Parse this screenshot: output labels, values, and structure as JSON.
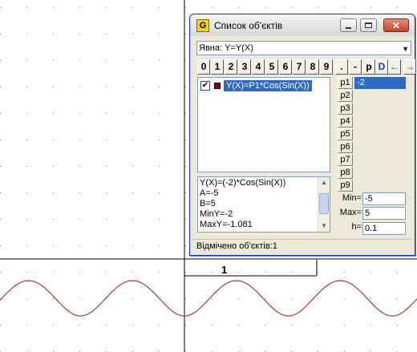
{
  "canvas": {
    "axis_tick_label": "1",
    "curve_color": "#a83a3a"
  },
  "window": {
    "app_icon_letter": "G",
    "title": "Список об'єктів"
  },
  "combo": {
    "value": "Явна: Y=Y(X)"
  },
  "keypad": [
    "0",
    "1",
    "2",
    "3",
    "4",
    "5",
    "6",
    "7",
    "8",
    "9",
    ".",
    "-",
    "p",
    "D",
    "←",
    "→"
  ],
  "objects": [
    {
      "checked": true,
      "color": "#8b0000",
      "label": "Y(X)=P1*Cos(Sin(X))"
    }
  ],
  "parameters": {
    "names": [
      "p1",
      "p2",
      "p3",
      "p4",
      "p5",
      "p6",
      "p7",
      "p8",
      "p9"
    ],
    "p1_value": "-2"
  },
  "properties": [
    "Y(X)=(-2)*Cos(Sin(X))",
    "A=-5",
    "B=5",
    "MinY=-2",
    "MaxY=-1.081"
  ],
  "range": {
    "min_label": "Min=",
    "min_value": "-5",
    "max_label": "Max=",
    "max_value": "5",
    "h_label": "h=",
    "h_value": "0.1"
  },
  "status": "Відмічено об'єктів:1"
}
